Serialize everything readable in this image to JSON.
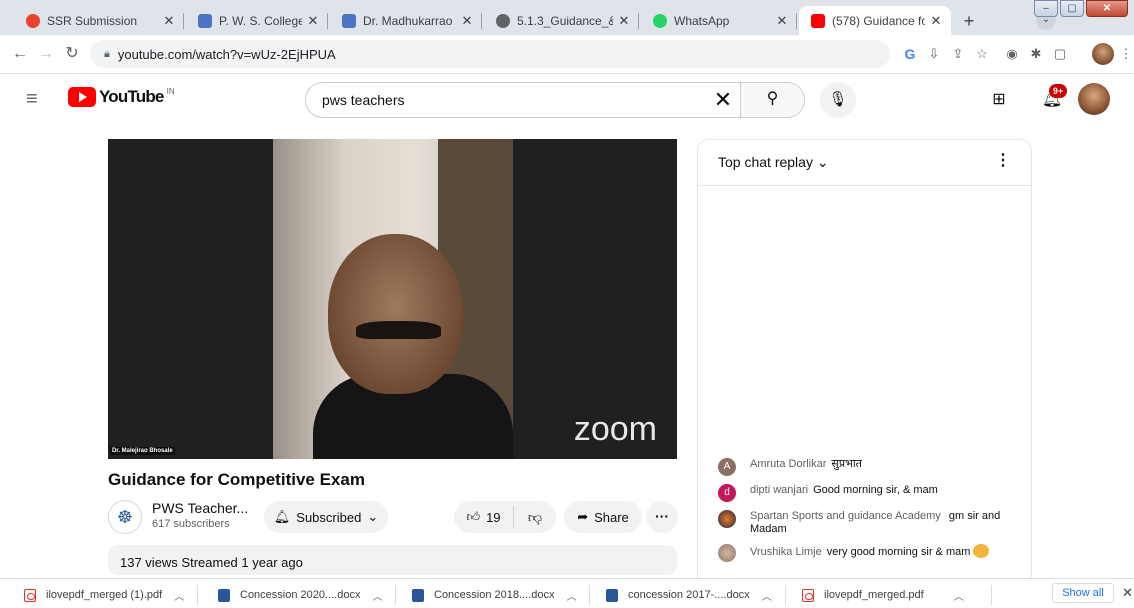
{
  "browser": {
    "tabs": [
      {
        "title": "SSR Submission",
        "favicon_color": "#e8442c",
        "active": false
      },
      {
        "title": "P. W. S. College, Nagpu",
        "favicon_color": "#4a74c4",
        "active": false
      },
      {
        "title": "Dr. Madhukarrao Wasn",
        "favicon_color": "#4a74c4",
        "active": false
      },
      {
        "title": "5.1.3_Guidance_&_Cou",
        "favicon_color": "#5f6368",
        "active": false
      },
      {
        "title": "WhatsApp",
        "favicon_color": "#25d366",
        "active": false
      },
      {
        "title": "(578) Guidance for Con",
        "favicon_color": "#ff0000",
        "active": true
      }
    ],
    "new_tab_glyph": "+",
    "close_glyph": "✕",
    "url": "youtube.com/watch?v=wUz-2EjHPUA",
    "window_controls": [
      "–",
      "▢",
      "✕"
    ]
  },
  "youtube": {
    "logo_text": "YouTube",
    "country_code": "IN",
    "search": {
      "value": "pws teachers",
      "clear_glyph": "✕",
      "search_glyph": "⚲"
    },
    "notification_badge": "9+",
    "video": {
      "title": "Guidance for Competitive Exam",
      "speaker_label": "Dr. Malejirao Bhosale",
      "watermark": "zoom"
    },
    "channel": {
      "name": "PWS Teacher...",
      "subscribers": "617 subscribers",
      "subscribe_label": "Subscribed"
    },
    "actions": {
      "like_count": "19",
      "share_label": "Share",
      "more_glyph": "···"
    },
    "description": {
      "summary": "137 views  Streamed 1 year ago"
    },
    "chat": {
      "header": "Top chat replay",
      "messages": [
        {
          "initial": "A",
          "author": "Amruta Dorlikar",
          "text": "सुप्रभात",
          "avatar_color": "#8d6e63"
        },
        {
          "initial": "d",
          "author": "dipti wanjari",
          "text": "Good morning sir, & mam",
          "avatar_color": "#c2185b"
        },
        {
          "initial": "",
          "author": "Spartan Sports and guidance Academy",
          "text": "gm sir and Madam",
          "avatar_color": "#5d4037"
        },
        {
          "initial": "",
          "author": "Vrushika Limje",
          "text": "very good morning sir & mam",
          "avatar_color": "#a1887f"
        }
      ]
    }
  },
  "downloads": {
    "items": [
      {
        "name": "ilovepdf_merged (1).pdf",
        "type": "pdf"
      },
      {
        "name": "Concession 2020....docx",
        "type": "docx"
      },
      {
        "name": "Concession 2018....docx",
        "type": "docx"
      },
      {
        "name": "concession 2017-....docx",
        "type": "docx"
      },
      {
        "name": "ilovepdf_merged.pdf",
        "type": "pdf"
      }
    ],
    "show_all_label": "Show all",
    "close_glyph": "✕"
  }
}
